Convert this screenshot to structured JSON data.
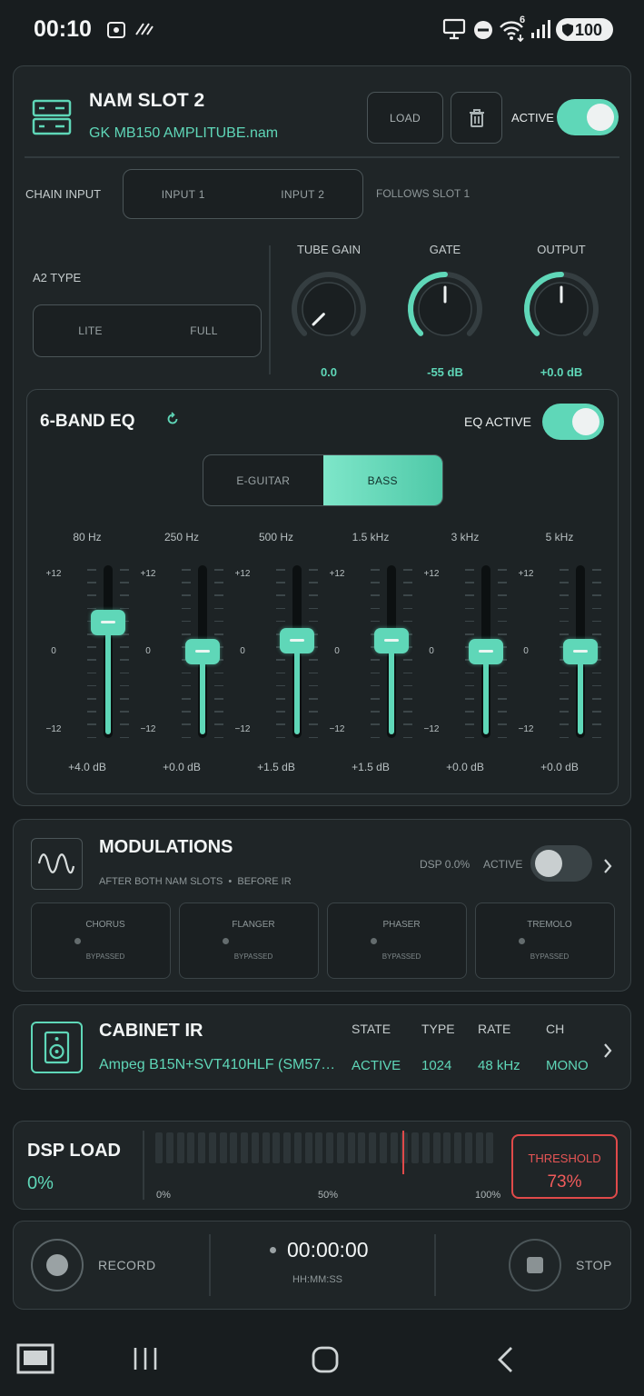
{
  "status_bar": {
    "time": "00:10",
    "battery": "100",
    "wifi_badge": "6"
  },
  "nam_slot": {
    "title": "NAM SLOT 2",
    "file": "GK MB150 AMPLITUBE.nam",
    "load_label": "LOAD",
    "active_label": "ACTIVE",
    "active": true
  },
  "chain_input": {
    "label": "CHAIN INPUT",
    "options": [
      "INPUT 1",
      "INPUT 2"
    ],
    "follows": "FOLLOWS SLOT 1"
  },
  "a2_type": {
    "label": "A2 TYPE",
    "options": [
      "LITE",
      "FULL"
    ]
  },
  "knobs": [
    {
      "label": "TUBE GAIN",
      "value": "0.0",
      "level": 0.0
    },
    {
      "label": "GATE",
      "value": "-55 dB",
      "level": 0.5
    },
    {
      "label": "OUTPUT",
      "value": "+0.0 dB",
      "level": 0.5
    }
  ],
  "eq": {
    "title": "6-BAND EQ",
    "active_label": "EQ ACTIVE",
    "active": true,
    "modes": [
      "E-GUITAR",
      "BASS"
    ],
    "selected_mode": "BASS",
    "scale": {
      "max": "+12",
      "mid": "0",
      "min": "−12"
    },
    "range": [
      -12,
      12
    ],
    "bands": [
      {
        "freq": "80 Hz",
        "gain": 4.0,
        "label": "+4.0 dB"
      },
      {
        "freq": "250 Hz",
        "gain": 0.0,
        "label": "+0.0 dB"
      },
      {
        "freq": "500 Hz",
        "gain": 1.5,
        "label": "+1.5 dB"
      },
      {
        "freq": "1.5 kHz",
        "gain": 1.5,
        "label": "+1.5 dB"
      },
      {
        "freq": "3 kHz",
        "gain": 0.0,
        "label": "+0.0 dB"
      },
      {
        "freq": "5 kHz",
        "gain": 0.0,
        "label": "+0.0 dB"
      }
    ]
  },
  "modulations": {
    "title": "MODULATIONS",
    "subtitle": "AFTER BOTH NAM SLOTS  •  BEFORE IR",
    "dsp": "DSP 0.0%",
    "active_label": "ACTIVE",
    "active": false,
    "effects": [
      {
        "name": "CHORUS",
        "state": "BYPASSED"
      },
      {
        "name": "FLANGER",
        "state": "BYPASSED"
      },
      {
        "name": "PHASER",
        "state": "BYPASSED"
      },
      {
        "name": "TREMOLO",
        "state": "BYPASSED"
      }
    ]
  },
  "cabinet": {
    "title": "CABINET IR",
    "ir_name": "Ampeg B15N+SVT410HLF (SM57…",
    "columns": [
      {
        "header": "STATE",
        "value": "ACTIVE"
      },
      {
        "header": "TYPE",
        "value": "1024"
      },
      {
        "header": "RATE",
        "value": "48 kHz"
      },
      {
        "header": "CH",
        "value": "MONO"
      }
    ]
  },
  "dsp_load": {
    "title": "DSP LOAD",
    "value": "0%",
    "ticks": [
      "0%",
      "50%",
      "100%"
    ],
    "threshold_label": "THRESHOLD",
    "threshold_value": "73%",
    "threshold": 0.73
  },
  "recorder": {
    "record_label": "RECORD",
    "time": "00:00:00",
    "format": "HH:MM:SS",
    "stop_label": "STOP"
  }
}
